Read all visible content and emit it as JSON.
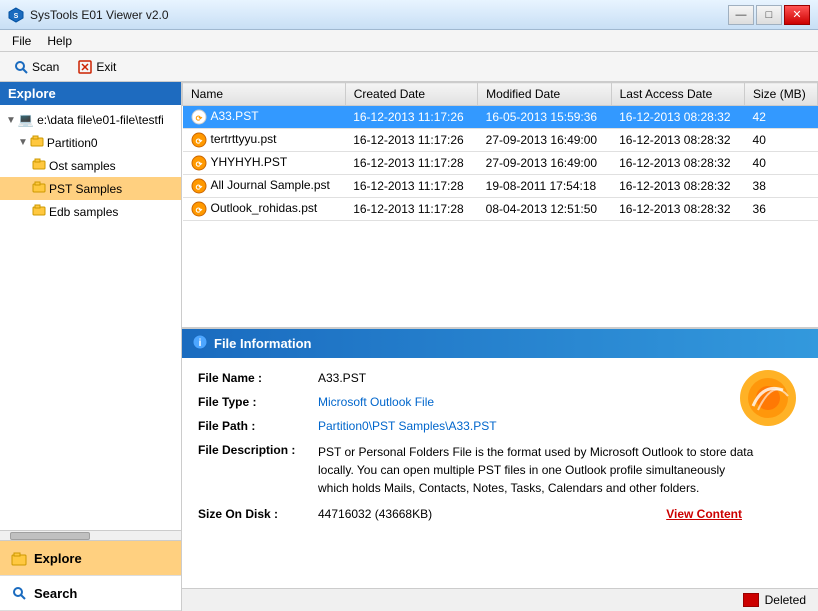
{
  "titlebar": {
    "title": "SysTools E01 Viewer v2.0",
    "min_label": "—",
    "max_label": "□",
    "close_label": "✕"
  },
  "menubar": {
    "items": [
      "File",
      "Help"
    ]
  },
  "toolbar": {
    "scan_label": "Scan",
    "exit_label": "Exit"
  },
  "sidebar": {
    "header": "Explore",
    "tree": [
      {
        "label": "e:\\data file\\e01-file\\testfi",
        "level": 0,
        "type": "drive",
        "icon": "💻"
      },
      {
        "label": "Partition0",
        "level": 1,
        "type": "partition",
        "icon": "📁"
      },
      {
        "label": "Ost samples",
        "level": 2,
        "type": "folder",
        "icon": "📁"
      },
      {
        "label": "PST Samples",
        "level": 2,
        "type": "folder-selected",
        "icon": "📁"
      },
      {
        "label": "Edb samples",
        "level": 2,
        "type": "folder",
        "icon": "📁"
      }
    ],
    "tabs": [
      {
        "label": "Explore",
        "icon": "folder",
        "active": true
      },
      {
        "label": "Search",
        "icon": "search",
        "active": false
      }
    ]
  },
  "file_list": {
    "columns": [
      "Name",
      "Created Date",
      "Modified Date",
      "Last Access Date",
      "Size (MB)"
    ],
    "rows": [
      {
        "name": "A33.PST",
        "created": "16-12-2013 11:17:26",
        "modified": "16-05-2013 15:59:36",
        "accessed": "16-12-2013 08:28:32",
        "size": "42",
        "selected": true
      },
      {
        "name": "tertrttyyu.pst",
        "created": "16-12-2013 11:17:26",
        "modified": "27-09-2013 16:49:00",
        "accessed": "16-12-2013 08:28:32",
        "size": "40",
        "selected": false
      },
      {
        "name": "YHYHYH.PST",
        "created": "16-12-2013 11:17:28",
        "modified": "27-09-2013 16:49:00",
        "accessed": "16-12-2013 08:28:32",
        "size": "40",
        "selected": false
      },
      {
        "name": "All Journal Sample.pst",
        "created": "16-12-2013 11:17:28",
        "modified": "19-08-2011 17:54:18",
        "accessed": "16-12-2013 08:28:32",
        "size": "38",
        "selected": false
      },
      {
        "name": "Outlook_rohidas.pst",
        "created": "16-12-2013 11:17:28",
        "modified": "08-04-2013 12:51:50",
        "accessed": "16-12-2013 08:28:32",
        "size": "36",
        "selected": false
      }
    ]
  },
  "file_info": {
    "header_label": "File Information",
    "fields": [
      {
        "label": "File Name :",
        "value": "A33.PST",
        "style": "normal"
      },
      {
        "label": "File Type :",
        "value": "Microsoft Outlook File",
        "style": "blue"
      },
      {
        "label": "File Path :",
        "value": "Partition0\\PST Samples\\A33.PST",
        "style": "blue"
      },
      {
        "label": "File Description :",
        "value": "PST or Personal Folders File is the format used by Microsoft Outlook to store data locally. You can open multiple PST files in one Outlook profile simultaneously which holds Mails, Contacts, Notes, Tasks, Calendars and other folders.",
        "style": "description"
      },
      {
        "label": "Size On Disk :",
        "value": "44716032 (43668KB)",
        "style": "normal"
      }
    ],
    "view_content_label": "View Content"
  },
  "legend": {
    "label": "Deleted"
  }
}
